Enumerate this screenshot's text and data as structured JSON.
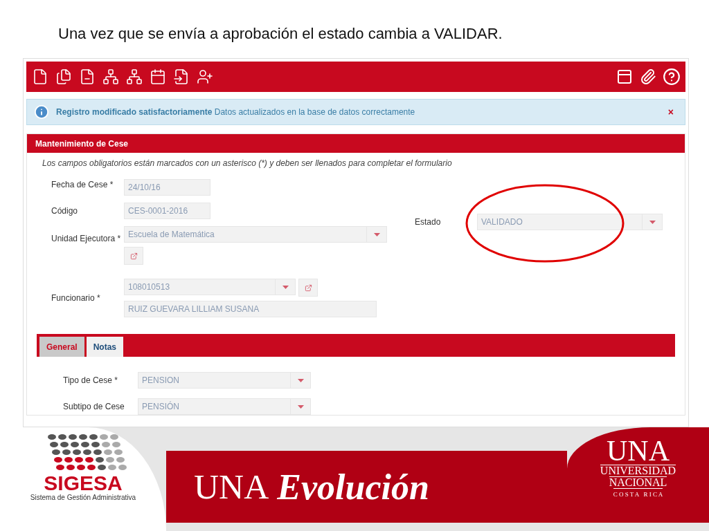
{
  "slide_title": "Una vez que se envía a aprobación el estado cambia a VALIDAR.",
  "message": {
    "title": "Registro modificado satisfactoriamente",
    "text": "Datos actualizados en la base de datos correctamente",
    "close": "×"
  },
  "panel": {
    "title": "Mantenimiento de Cese",
    "hint": "Los campos obligatorios están marcados con un asterisco (*) y deben ser llenados para completar el formulario"
  },
  "fields": [
    {
      "label": "Fecha de Cese *",
      "kind": "text",
      "value": "24/10/16"
    },
    {
      "label": "Código",
      "kind": "text",
      "value": "CES-0001-2016"
    },
    {
      "label": "Unidad Ejecutora *",
      "kind": "select_link_below",
      "value": "Escuela de Matemática"
    },
    {
      "label": "Funcionario *",
      "kind": "select_link_name",
      "value": "108010513",
      "name": "RUIZ  GUEVARA LILLIAM SUSANA"
    }
  ],
  "estado": {
    "label": "Estado",
    "value": "VALIDADO",
    "circled": true
  },
  "tabs": [
    {
      "label": "General",
      "selected": false
    },
    {
      "label": "Notas",
      "selected": true
    }
  ],
  "tab_fields": [
    {
      "label": "Tipo de Cese *",
      "value": "PENSION"
    },
    {
      "label": "Subtipo de Cese",
      "value": "PENSIÓN"
    }
  ],
  "footer": {
    "brand": "SIGESA",
    "brand_sub": "Sistema de Gestión Administrativa",
    "slogan_a": "UNA",
    "slogan_b": "Evolución",
    "logo": "UNA",
    "logo_lines": [
      "UNIVERSIDAD",
      "NACIONAL",
      "C O S T A   R I C A"
    ]
  }
}
